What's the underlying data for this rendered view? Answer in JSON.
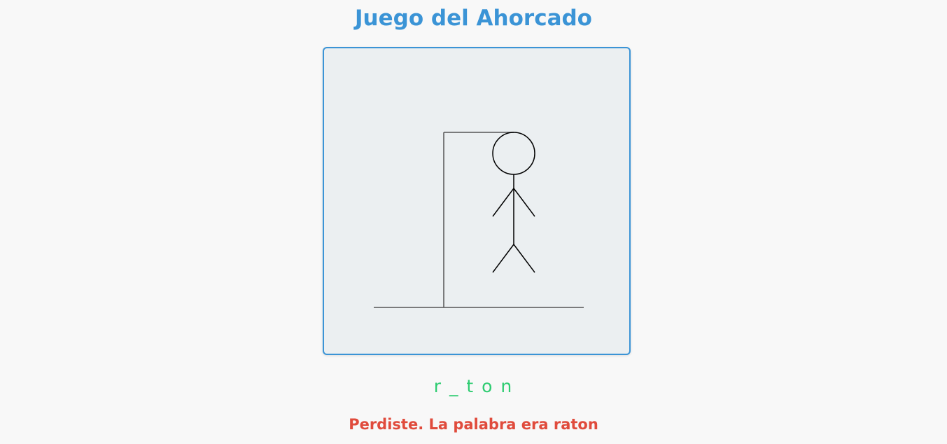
{
  "game": {
    "title": "Juego del Ahorcado",
    "word_display": "r _ t o n",
    "result_message": "Perdiste. La palabra era raton"
  },
  "colors": {
    "title": "#3b94d6",
    "board_border": "#3b94d6",
    "board_bg": "#ebeff1",
    "word": "#2ecc71",
    "message": "#e04b3c"
  }
}
